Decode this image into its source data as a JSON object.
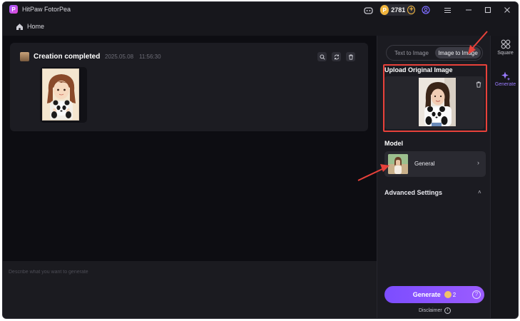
{
  "window": {
    "title": "HitPaw FotorPea"
  },
  "titlebar": {
    "coins": "2781",
    "coin_symbol": "P",
    "coin_plus": "+"
  },
  "breadcrumb": {
    "home_label": "Home"
  },
  "card": {
    "title": "Creation completed",
    "date": "2025.05.08",
    "time": "11:56:30"
  },
  "prompt": {
    "placeholder": "Describe what you want to generate"
  },
  "panel": {
    "tabs": [
      {
        "label": "Text to Image",
        "active": false
      },
      {
        "label": "Image to Image",
        "active": true
      }
    ],
    "upload_title": "Upload Original Image",
    "model_title": "Model",
    "model_name": "General",
    "model_chevron": "›",
    "advanced_title": "Advanced Settings",
    "advanced_chevron": "˄",
    "generate_label": "Generate",
    "generate_cost": "2",
    "help_symbol": "?",
    "disclaimer": "Disclaimer",
    "info_symbol": "i"
  },
  "rail": {
    "items": [
      {
        "label": "Square",
        "active": false
      },
      {
        "label": "Generate",
        "active": true
      }
    ]
  },
  "colors": {
    "accent": "#8a63ff",
    "highlight": "#e8413a",
    "coin": "#f0b43c"
  }
}
